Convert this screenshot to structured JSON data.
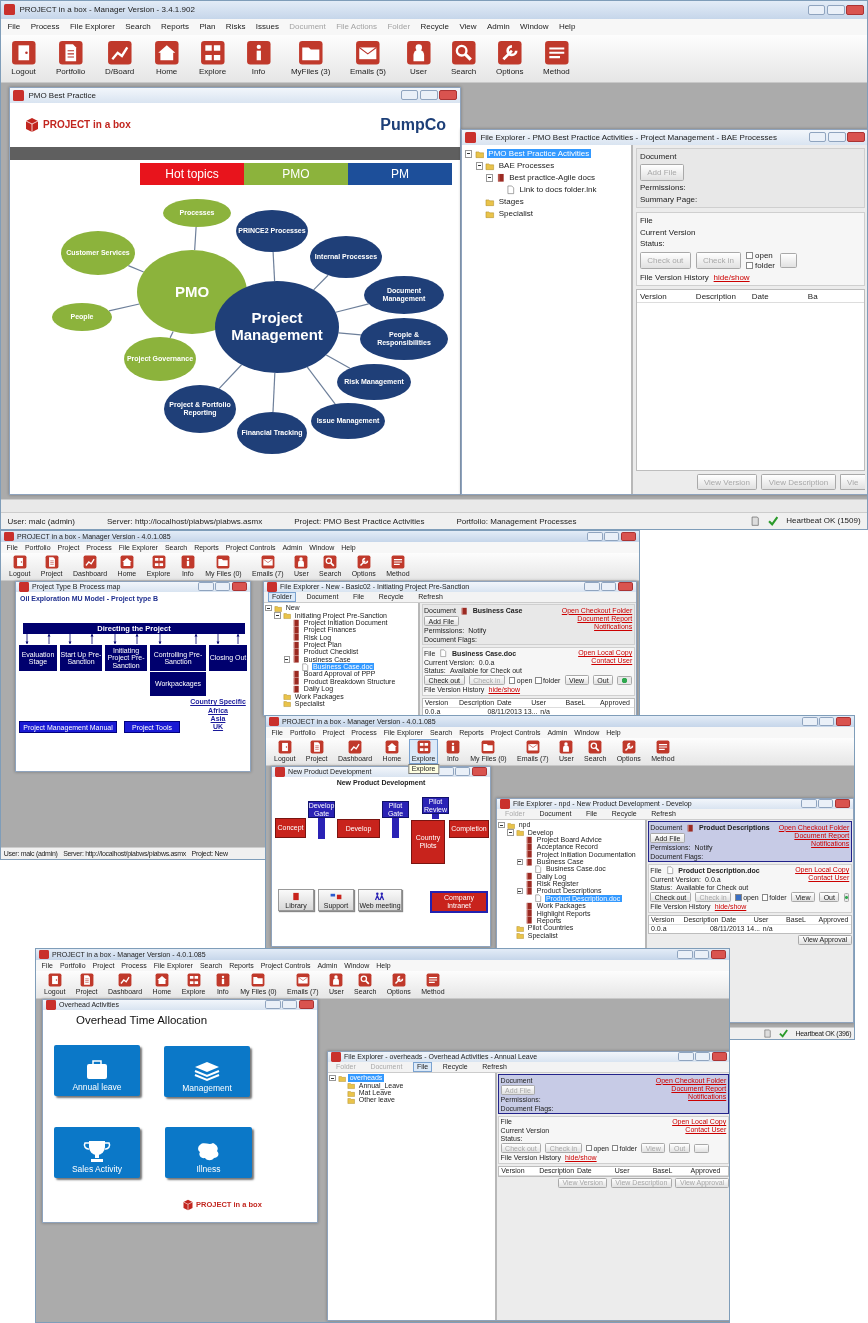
{
  "screens": [
    {
      "window_title": "PROJECT in a box - Manager Version - 3.4.1.902",
      "menu": [
        {
          "label": "File",
          "disabled": false
        },
        {
          "label": "Process",
          "disabled": false
        },
        {
          "label": "File Explorer",
          "disabled": false
        },
        {
          "label": "Search",
          "disabled": false
        },
        {
          "label": "Reports",
          "disabled": false
        },
        {
          "label": "Plan",
          "disabled": false
        },
        {
          "label": "Risks",
          "disabled": false
        },
        {
          "label": "Issues",
          "disabled": false
        },
        {
          "label": "Document",
          "disabled": true
        },
        {
          "label": "File Actions",
          "disabled": true
        },
        {
          "label": "Folder",
          "disabled": true
        },
        {
          "label": "Recycle",
          "disabled": false
        },
        {
          "label": "View",
          "disabled": false
        },
        {
          "label": "Admin",
          "disabled": false
        },
        {
          "label": "Window",
          "disabled": false
        },
        {
          "label": "Help",
          "disabled": false
        }
      ],
      "toolbar": [
        "Logout",
        "Portfolio",
        "D/Board",
        "Home",
        "Explore",
        "Info",
        "MyFiles (3)",
        "Emails (5)",
        "User",
        "Search",
        "Options",
        "Method"
      ],
      "documents": [
        {
          "kind": "mindmap",
          "title": "PMO Best Practice",
          "logo": "PROJECT in a box",
          "company": "PumpCo",
          "tabs": [
            {
              "label": "Hot topics",
              "color": "#e8141c"
            },
            {
              "label": "PMO",
              "color": "#8cb33c"
            },
            {
              "label": "PM",
              "color": "#1d4f9a"
            }
          ],
          "hubs": [
            {
              "label": "PMO",
              "color": "#8cb33c",
              "topics": [
                "Processes",
                "Customer Services",
                "People",
                "Project Governance"
              ]
            },
            {
              "label": "Project Management",
              "color": "#1f3f78",
              "topics": [
                "PRINCE2 Processes",
                "Internal Processes",
                "Document Management",
                "People & Responsibilities",
                "Risk Management",
                "Issue Management",
                "Financial Tracking",
                "Project & Portfolio Reporting"
              ]
            }
          ]
        },
        {
          "kind": "file_explorer",
          "title": "File Explorer - PMO Best Practice Activities - Project Management - BAE Processes",
          "tree": [
            {
              "label": "PMO Best Practice Activities",
              "kind": "folder",
              "selected": true,
              "children": [
                {
                  "label": "BAE Processes",
                  "kind": "folder",
                  "selected": false,
                  "children": [
                    {
                      "label": "Best practice-Agile docs",
                      "kind": "binder",
                      "selected": false,
                      "children": [
                        {
                          "label": "Link to docs folder.lnk",
                          "kind": "file",
                          "selected": false
                        }
                      ]
                    }
                  ]
                },
                {
                  "label": "Stages",
                  "kind": "folder",
                  "selected": false
                },
                {
                  "label": "Specialist",
                  "kind": "folder",
                  "selected": false
                }
              ]
            }
          ],
          "document": {
            "label": "Document",
            "highlighted": false,
            "add_button": {
              "label": "Add File",
              "disabled": true
            },
            "fields": [
              {
                "label": "Permissions:"
              },
              {
                "label": "Summary Page:"
              }
            ]
          },
          "file": {
            "label": "File",
            "fields": [
              {
                "label": "Current Version"
              },
              {
                "label": "Status:"
              }
            ],
            "actions": [
              {
                "kind": "button",
                "label": "Check out",
                "disabled": true
              },
              {
                "kind": "button",
                "label": "Check in",
                "disabled": true
              },
              {
                "kind": "checkboxes",
                "options": [
                  {
                    "label": "open",
                    "checked": false
                  },
                  {
                    "label": "folder",
                    "checked": false
                  }
                ]
              },
              {
                "kind": "icon_button",
                "disabled": true
              }
            ],
            "history_label": "File Version History",
            "history_link": "hide/show"
          },
          "table": {
            "columns": [
              "Version",
              "Description",
              "Date",
              "Ba"
            ]
          },
          "bottom_buttons": [
            {
              "label": "View Version",
              "disabled": true,
              "partial": false
            },
            {
              "label": "View Description",
              "disabled": true,
              "partial": false
            },
            {
              "label": "Vie",
              "disabled": true,
              "partial": true
            }
          ]
        }
      ],
      "status_bar": {
        "left": [
          "User: malc (admin)",
          "Server: http://localhost/piabws/piabws.asmx",
          "Project: PMO Best Practice Activities",
          "Portfolio: Management Processes"
        ],
        "right": [
          "Heartbeat OK (1509)"
        ]
      }
    },
    {
      "window_title": "PROJECT in a box - Manager Version - 4.0.1.085",
      "menu": [
        "File",
        "Portfolio",
        "Project",
        "Process",
        "File Explorer",
        "Search",
        "Reports",
        "Project Controls",
        "Admin",
        "Window",
        "Help"
      ],
      "toolbar": [
        "Logout",
        "Project",
        "Dashboard",
        "Home",
        "Explore",
        "Info",
        "My Files (0)",
        "Emails (7)",
        "User",
        "Search",
        "Options",
        "Method"
      ],
      "documents": [
        {
          "kind": "process_map",
          "title": "Project Type B Process map",
          "heading": "Oil Exploration MU Model - Project type B",
          "banner": "Directing the Project",
          "stages": [
            "Evaluation Stage",
            "Start Up Pre-Sanction",
            "Initiating Project Pre-Sanction",
            "Controlling Pre-Sanction",
            "Workpackages",
            "Closing Out"
          ],
          "buttons": [
            "Project Management Manual",
            "Project Tools"
          ],
          "links": [
            "Country Specific",
            "Africa",
            "Asia",
            "UK"
          ]
        },
        {
          "kind": "file_explorer",
          "title": "File Explorer - New - Basic02 - Initiating Project Pre-Sanction",
          "tabs": [
            {
              "label": "Folder",
              "selected": true,
              "disabled": false
            },
            {
              "label": "Document",
              "selected": false,
              "disabled": false
            },
            {
              "label": "File",
              "selected": false,
              "disabled": false
            },
            {
              "label": "Recycle",
              "selected": false,
              "disabled": false
            },
            {
              "label": "Refresh",
              "selected": false,
              "disabled": false
            }
          ],
          "tree": [
            {
              "label": "New",
              "kind": "folder",
              "selected": false,
              "children": [
                {
                  "label": "Initiating Project Pre-Sanction",
                  "kind": "folder",
                  "selected": false,
                  "children": [
                    {
                      "label": "Project Initiation Document",
                      "kind": "binder",
                      "selected": false
                    },
                    {
                      "label": "Project Finances",
                      "kind": "binder",
                      "selected": false
                    },
                    {
                      "label": "Risk Log",
                      "kind": "binder",
                      "selected": false
                    },
                    {
                      "label": "Project Plan",
                      "kind": "binder",
                      "selected": false
                    },
                    {
                      "label": "Product Checklist",
                      "kind": "binder",
                      "selected": false
                    },
                    {
                      "label": "Business Case",
                      "kind": "binder",
                      "selected": false,
                      "children": [
                        {
                          "label": "Business Case.doc",
                          "kind": "file",
                          "selected": true
                        }
                      ]
                    },
                    {
                      "label": "Board Approval of PPP",
                      "kind": "binder",
                      "selected": false
                    },
                    {
                      "label": "Product Breakdown Structure",
                      "kind": "binder",
                      "selected": false
                    },
                    {
                      "label": "Daily Log",
                      "kind": "binder",
                      "selected": false
                    }
                  ]
                },
                {
                  "label": "Work Packages",
                  "kind": "folder",
                  "selected": false
                },
                {
                  "label": "Specialist",
                  "kind": "folder",
                  "selected": false
                }
              ]
            }
          ],
          "document": {
            "label": "Document",
            "name": "Business Case",
            "highlighted": false,
            "add_button": {
              "label": "Add File",
              "disabled": false
            },
            "links": [
              "Open Checkout Folder",
              "Document Report",
              "Notifications"
            ],
            "fields": [
              {
                "label": "Permissions:",
                "value": "Notify"
              },
              {
                "label": "Document Flags:"
              }
            ]
          },
          "file": {
            "label": "File",
            "name": "Business Case.doc",
            "fields": [
              {
                "label": "Current Version:",
                "value": "0.0.a"
              },
              {
                "label": "Status:",
                "value": "Available for Check out"
              }
            ],
            "links": [
              "Open Local Copy",
              "Contact User"
            ],
            "actions": [
              {
                "kind": "button",
                "label": "Check out",
                "disabled": false
              },
              {
                "kind": "button",
                "label": "Check in",
                "disabled": true
              },
              {
                "kind": "checkboxes",
                "options": [
                  {
                    "label": "open",
                    "checked": false
                  },
                  {
                    "label": "folder",
                    "checked": false
                  }
                ]
              },
              {
                "kind": "button",
                "label": "View",
                "disabled": false
              },
              {
                "kind": "button",
                "label": "Out",
                "disabled": false
              },
              {
                "kind": "icon_button",
                "disabled": false
              }
            ],
            "history_label": "File Version History",
            "history_link": "hide/show"
          },
          "table": {
            "columns": [
              "Version",
              "Description",
              "Date",
              "User",
              "BaseL",
              "Approved"
            ],
            "rows": [
              [
                "0.0.a",
                null,
                "08/11/2013 13...",
                "n/a",
                null,
                null
              ]
            ]
          }
        }
      ],
      "status_bar": {
        "left": [
          "User: malc (admin)",
          "Server: http://localhost/piabws/piabws.asmx",
          "Project: New"
        ]
      }
    },
    {
      "window_title": "PROJECT in a box - Manager Version - 4.0.1.085",
      "menu": [
        "File",
        "Portfolio",
        "Project",
        "Process",
        "File Explorer",
        "Search",
        "Reports",
        "Project Controls",
        "Admin",
        "Window",
        "Help"
      ],
      "toolbar": [
        "Logout",
        "Project",
        "Dashboard",
        "Home",
        "Explore",
        "Info",
        "My Files (0)",
        "Emails (7)",
        "User",
        "Search",
        "Options",
        "Method"
      ],
      "toolbar_hover": [
        false,
        false,
        false,
        false,
        true,
        false,
        false,
        false,
        false,
        false,
        false,
        false
      ],
      "tooltip": "Explore",
      "documents": [
        {
          "kind": "npd_map",
          "title": "New Product Development",
          "heading": "New Product Development",
          "phases": [
            "Concept",
            "Develop",
            "Country Pilots",
            "Completion"
          ],
          "gates": [
            "Develop Gate",
            "Pilot Gate",
            "Pilot Review"
          ],
          "buttons": [
            "Library",
            "Support",
            "Web meeting",
            "Company Intranet"
          ]
        },
        {
          "kind": "file_explorer",
          "title": "File Explorer - npd - New Product Development - Develop",
          "tabs": [
            {
              "label": "Folder",
              "selected": false,
              "disabled": true
            },
            {
              "label": "Document",
              "selected": false,
              "disabled": false
            },
            {
              "label": "File",
              "selected": false,
              "disabled": false
            },
            {
              "label": "Recycle",
              "selected": false,
              "disabled": false
            },
            {
              "label": "Refresh",
              "selected": false,
              "disabled": false
            }
          ],
          "tree": [
            {
              "label": "npd",
              "kind": "folder",
              "selected": false,
              "children": [
                {
                  "label": "Develop",
                  "kind": "folder",
                  "selected": false,
                  "children": [
                    {
                      "label": "Project Board Advice",
                      "kind": "binder",
                      "selected": false
                    },
                    {
                      "label": "Acceptance Record",
                      "kind": "binder",
                      "selected": false
                    },
                    {
                      "label": "Project Initiation Documentation",
                      "kind": "binder",
                      "selected": false
                    },
                    {
                      "label": "Business Case",
                      "kind": "binder",
                      "selected": false,
                      "children": [
                        {
                          "label": "Business Case.doc",
                          "kind": "file",
                          "selected": false
                        }
                      ]
                    },
                    {
                      "label": "Daily Log",
                      "kind": "binder",
                      "selected": false
                    },
                    {
                      "label": "Risk Register",
                      "kind": "binder",
                      "selected": false
                    },
                    {
                      "label": "Product Descriptions",
                      "kind": "binder",
                      "selected": false,
                      "children": [
                        {
                          "label": "Product Description.doc",
                          "kind": "file",
                          "selected": true
                        }
                      ]
                    },
                    {
                      "label": "Work Packages",
                      "kind": "binder",
                      "selected": false
                    },
                    {
                      "label": "Highlight Reports",
                      "kind": "binder",
                      "selected": false
                    },
                    {
                      "label": "Reports",
                      "kind": "binder",
                      "selected": false
                    }
                  ]
                },
                {
                  "label": "Pilot Countries",
                  "kind": "folder",
                  "selected": false
                },
                {
                  "label": "Specialist",
                  "kind": "folder",
                  "selected": false
                }
              ]
            }
          ],
          "document": {
            "label": "Document",
            "name": "Product Descriptions",
            "highlighted": true,
            "add_button": {
              "label": "Add File",
              "disabled": false
            },
            "links": [
              "Open Checkout Folder",
              "Document Report",
              "Notifications"
            ],
            "fields": [
              {
                "label": "Permissions:",
                "value": "Notify"
              },
              {
                "label": "Document Flags:"
              }
            ]
          },
          "file": {
            "label": "File",
            "name": "Product Description.doc",
            "fields": [
              {
                "label": "Current Version:",
                "value": "0.0.a"
              },
              {
                "label": "Status:",
                "value": "Available for Check out"
              }
            ],
            "links": [
              "Open Local Copy",
              "Contact User"
            ],
            "actions": [
              {
                "kind": "button",
                "label": "Check out",
                "disabled": false
              },
              {
                "kind": "button",
                "label": "Check in",
                "disabled": true
              },
              {
                "kind": "checkboxes",
                "options": [
                  {
                    "label": "open",
                    "checked": true
                  },
                  {
                    "label": "folder",
                    "checked": false
                  }
                ]
              },
              {
                "kind": "button",
                "label": "View",
                "disabled": false
              },
              {
                "kind": "button",
                "label": "Out",
                "disabled": false
              },
              {
                "kind": "icon_button",
                "disabled": false
              }
            ],
            "history_label": "File Version History",
            "history_link": "hide/show"
          },
          "table": {
            "columns": [
              "Version",
              "Description",
              "Date",
              "User",
              "BaseL",
              "Approved"
            ],
            "rows": [
              [
                "0.0.a",
                null,
                "08/11/2013 14...",
                "n/a",
                null,
                null
              ]
            ]
          },
          "bottom_buttons": [
            {
              "label": "View Approval",
              "disabled": false
            }
          ]
        }
      ],
      "status_bar": {
        "right": [
          "Heartbeat OK (396)"
        ]
      }
    },
    {
      "window_title": "PROJECT in a box - Manager Version - 4.0.1.085",
      "menu": [
        "File",
        "Portfolio",
        "Project",
        "Process",
        "File Explorer",
        "Search",
        "Reports",
        "Project Controls",
        "Admin",
        "Window",
        "Help"
      ],
      "toolbar": [
        "Logout",
        "Project",
        "Dashboard",
        "Home",
        "Explore",
        "Info",
        "My Files (0)",
        "Emails (7)",
        "User",
        "Search",
        "Options",
        "Method"
      ],
      "documents": [
        {
          "kind": "tile_menu",
          "title": "Overhead Activities",
          "heading": "Overhead Time Allocation",
          "tiles": [
            "Annual leave",
            "Management",
            "Sales Activity",
            "Illness"
          ],
          "logo": "PROJECT in a box"
        },
        {
          "kind": "file_explorer",
          "title": "File Explorer - overheads - Overhead Activities - Annual Leave",
          "tabs": [
            {
              "label": "Folder",
              "selected": false,
              "disabled": true
            },
            {
              "label": "Document",
              "selected": false,
              "disabled": true
            },
            {
              "label": "File",
              "selected": true,
              "disabled": false
            },
            {
              "label": "Recycle",
              "selected": false,
              "disabled": false
            },
            {
              "label": "Refresh",
              "selected": false,
              "disabled": false
            }
          ],
          "tree": [
            {
              "label": "overheads",
              "kind": "folder",
              "selected": true,
              "children": [
                {
                  "label": "Annual_Leave",
                  "kind": "folder",
                  "selected": false
                },
                {
                  "label": "Mat Leave",
                  "kind": "folder",
                  "selected": false
                },
                {
                  "label": "Other leave",
                  "kind": "folder",
                  "selected": false
                }
              ]
            }
          ],
          "document": {
            "label": "Document",
            "highlighted": true,
            "add_button": {
              "label": "Add File",
              "disabled": true
            },
            "links": [
              "Open Checkout Folder",
              "Document Report",
              "Notifications"
            ],
            "fields": [
              {
                "label": "Permissions:"
              },
              {
                "label": "Document Flags:"
              }
            ]
          },
          "file": {
            "label": "File",
            "fields": [
              {
                "label": "Current Version"
              },
              {
                "label": "Status:"
              }
            ],
            "links": [
              "Open Local Copy",
              "Contact User"
            ],
            "actions": [
              {
                "kind": "button",
                "label": "Check out",
                "disabled": true
              },
              {
                "kind": "button",
                "label": "Check in",
                "disabled": true
              },
              {
                "kind": "checkboxes",
                "options": [
                  {
                    "label": "open",
                    "checked": false
                  },
                  {
                    "label": "folder",
                    "checked": false
                  }
                ]
              },
              {
                "kind": "button",
                "label": "View",
                "disabled": true
              },
              {
                "kind": "button",
                "label": "Out",
                "disabled": true
              },
              {
                "kind": "icon_button",
                "disabled": true
              }
            ],
            "history_label": "File Version History",
            "history_link": "hide/show"
          },
          "table": {
            "columns": [
              "Version",
              "Description",
              "Date",
              "User",
              "BaseL",
              "Approved"
            ]
          },
          "bottom_buttons": [
            {
              "label": "View Version",
              "disabled": true
            },
            {
              "label": "View Description",
              "disabled": true
            },
            {
              "label": "View Approval",
              "disabled": true
            }
          ]
        }
      ]
    }
  ]
}
